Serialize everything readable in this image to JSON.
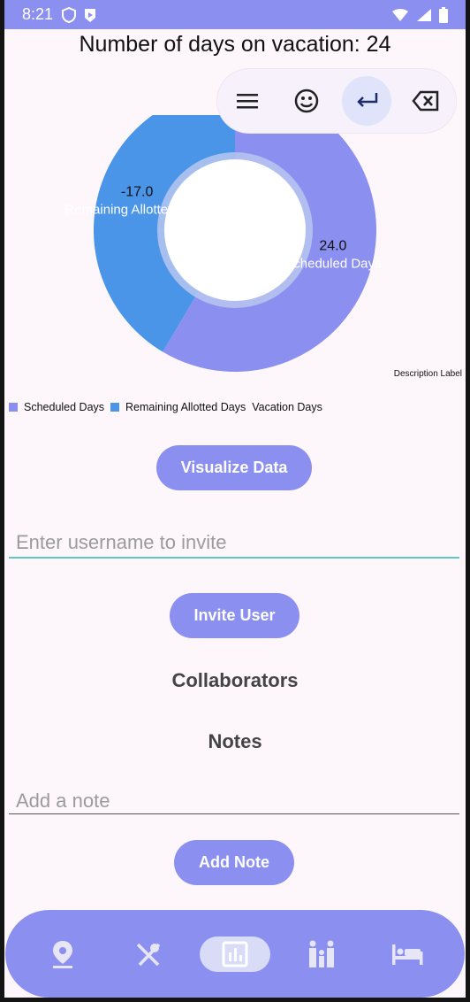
{
  "status_bar": {
    "time": "8:21",
    "icons": [
      "shield-icon",
      "play-protect-icon",
      "wifi-icon",
      "signal-icon",
      "battery-icon"
    ]
  },
  "page_title": "Number of days on vacation: 24",
  "keyboard_toolbar": {
    "items": [
      "menu-icon",
      "emoji-icon",
      "enter-icon",
      "backspace-icon"
    ],
    "active_item": "enter-icon"
  },
  "chart_data": {
    "type": "pie",
    "title": "",
    "slices": [
      {
        "label": "Scheduled Days",
        "value": 24.0,
        "color": "#8b8ff0"
      },
      {
        "label": "Remaining Allotted Days",
        "value": -17.0,
        "color": "#4a95e8"
      }
    ],
    "slice_value_labels": [
      "24.0",
      "-17.0"
    ],
    "description_label": "Description Label",
    "legend": {
      "entries": [
        "Scheduled Days",
        "Remaining Allotted Days"
      ],
      "series_label": "Vacation Days",
      "placement": "bottom-left"
    },
    "hole": true
  },
  "buttons": {
    "visualize": "Visualize Data",
    "invite": "Invite User",
    "add_note": "Add Note"
  },
  "inputs": {
    "invite_placeholder": "Enter username to invite",
    "note_placeholder": "Add a note"
  },
  "headings": {
    "collaborators": "Collaborators",
    "notes": "Notes"
  },
  "bottom_nav": {
    "items": [
      "location-pin-icon",
      "dining-icon",
      "chart-icon",
      "family-icon",
      "hotel-bed-icon"
    ],
    "active": "chart-icon"
  },
  "colors": {
    "accent": "#8b8ff0",
    "secondary": "#4a95e8",
    "background": "#fdf7fb",
    "input_focus_line": "#5fc7c1"
  }
}
